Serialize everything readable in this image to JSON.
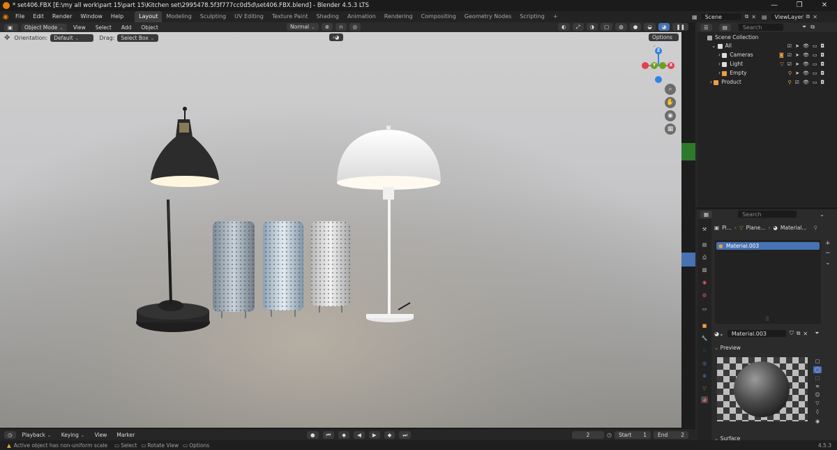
{
  "titlebar": {
    "title": "* set406.FBX [E:\\my all work\\part 15\\part 15\\Kitchen set\\2995478.5f3f777cc0d5d\\set406.FBX.blend] - Blender 4.5.3 LTS",
    "minimize": "—",
    "maximize": "❐",
    "close": "✕"
  },
  "menu": [
    "File",
    "Edit",
    "Render",
    "Window",
    "Help"
  ],
  "workspaces": [
    "Layout",
    "Modeling",
    "Sculpting",
    "UV Editing",
    "Texture Paint",
    "Shading",
    "Animation",
    "Rendering",
    "Compositing",
    "Geometry Nodes",
    "Scripting",
    "+"
  ],
  "scene": {
    "name": "Scene",
    "view_layer": "ViewLayer"
  },
  "viewport_header": {
    "mode": "Object Mode",
    "menus": [
      "View",
      "Select",
      "Add",
      "Object"
    ],
    "transform_orientation": "Normal",
    "options": "Options"
  },
  "viewport_sub": {
    "orientation_label": "Orientation:",
    "orientation_value": "Default",
    "drag_label": "Drag:",
    "drag_value": "Select Box"
  },
  "gizmo": {
    "z": "Z",
    "y": "Y",
    "x": "X"
  },
  "timeline": {
    "menus": [
      "Playback",
      "Keying",
      "View",
      "Marker"
    ],
    "current_frame": "2",
    "start_label": "Start",
    "start": "1",
    "end_label": "End",
    "end": "2"
  },
  "statusbar": {
    "warning": "Active object has non-uniform scale",
    "hints": [
      "Select",
      "Rotate View",
      "Options"
    ],
    "version": "4.5.3"
  },
  "outliner": {
    "search_placeholder": "Search",
    "root": "Scene Collection",
    "rows": [
      {
        "label": "All",
        "color": "#d8d8d8"
      },
      {
        "label": "Cameras",
        "color": "#d8d8d8"
      },
      {
        "label": "Light",
        "color": "#d8d8d8"
      },
      {
        "label": "Empty",
        "color": "#d8d8d8"
      },
      {
        "label": "Product",
        "color": "#d8d8d8"
      }
    ]
  },
  "properties": {
    "search_placeholder": "Search",
    "breadcrumb": [
      "Pl...",
      "Plane...",
      "Material..."
    ],
    "slots": [
      "Material.003"
    ],
    "material_name": "Material.003",
    "preview_label": "Preview",
    "surface_label": "Surface"
  },
  "colors": {
    "accent": "#4772b3",
    "blender_orange": "#e87d0d",
    "gizmo_x": "#e63e53",
    "gizmo_y": "#6ea11b",
    "gizmo_z": "#2f83e6"
  }
}
